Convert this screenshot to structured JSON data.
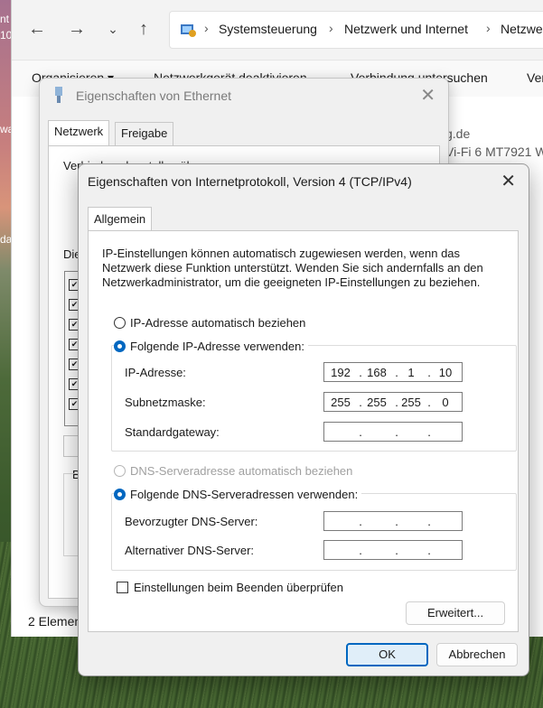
{
  "explorer": {
    "breadcrumbs": [
      "Systemsteuerung",
      "Netzwerk und Internet",
      "Netzwe"
    ],
    "commands": [
      "Organisieren ▾",
      "Netzwerkgerät deaktivieren",
      "Verbindung untersuchen",
      "Ver"
    ],
    "items": [
      "g.de",
      "Vi-Fi 6 MT7921 W"
    ],
    "status": "2 Elemen"
  },
  "ethernet_dialog": {
    "title": "Eigenschaften von Ethernet",
    "tabs": [
      "Netzwerk",
      "Freigabe"
    ],
    "partial_label": "Verbindung herstellen über:",
    "list_label": "Die",
    "b_label": "B"
  },
  "dialog": {
    "title": "Eigenschaften von Internetprotokoll, Version 4 (TCP/IPv4)",
    "tab": "Allgemein",
    "description": "IP-Einstellungen können automatisch zugewiesen werden, wenn das Netzwerk diese Funktion unterstützt. Wenden Sie sich andernfalls an den Netzwerkadministrator, um die geeigneten IP-Einstellungen zu beziehen.",
    "ip_auto_label": "IP-Adresse automatisch beziehen",
    "ip_manual_label": "Folgende IP-Adresse verwenden:",
    "ip_label": "IP-Adresse:",
    "ip_octets": [
      "192",
      "168",
      "1",
      "10"
    ],
    "subnet_label": "Subnetzmaske:",
    "subnet_octets": [
      "255",
      "255",
      "255",
      "0"
    ],
    "gateway_label": "Standardgateway:",
    "dns_auto_label": "DNS-Serveradresse automatisch beziehen",
    "dns_manual_label": "Folgende DNS-Serveradressen verwenden:",
    "dns_pref_label": "Bevorzugter DNS-Server:",
    "dns_alt_label": "Alternativer DNS-Server:",
    "validate_label": "Einstellungen beim Beenden überprüfen",
    "advanced_button": "Erweitert...",
    "ok_button": "OK",
    "cancel_button": "Abbrechen",
    "accent_color": "#0067c0"
  },
  "desktop": {
    "side_texts": [
      "nt",
      "10",
      "wa",
      "da"
    ]
  }
}
